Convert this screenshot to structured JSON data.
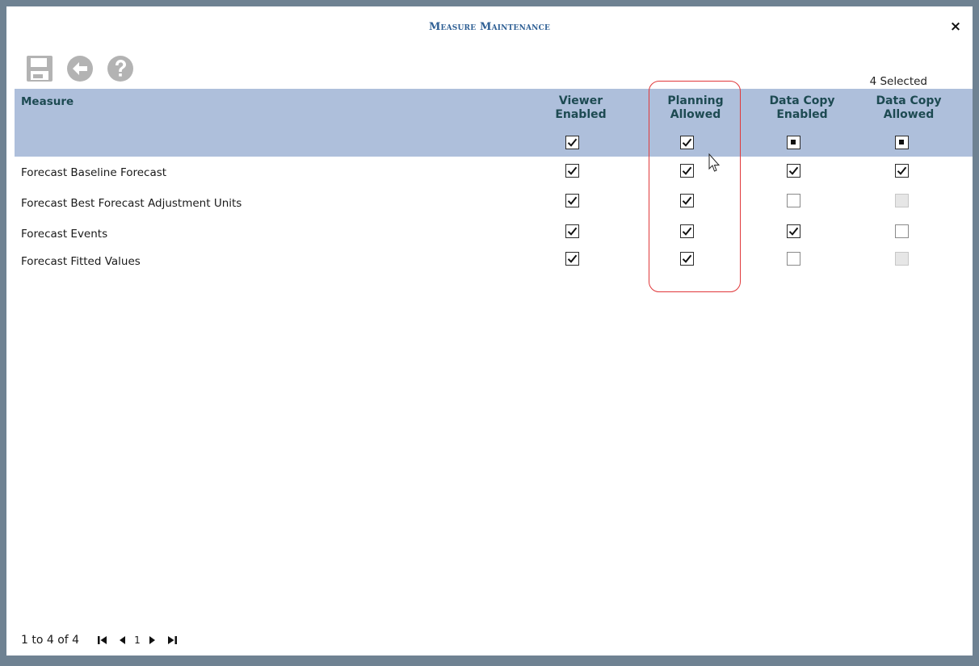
{
  "dialog": {
    "title": "Measure Maintenance",
    "close_label": "×"
  },
  "toolbar": {
    "save_icon": "save-icon",
    "back_icon": "back-arrow-icon",
    "help_icon": "help-icon",
    "selected_text": "4 Selected"
  },
  "table": {
    "header_measure": "Measure",
    "columns": [
      {
        "label": "Viewer\nEnabled",
        "header_state": "checked"
      },
      {
        "label": "Planning\nAllowed",
        "header_state": "checked"
      },
      {
        "label": "Data Copy\nEnabled",
        "header_state": "indeterminate"
      },
      {
        "label": "Data Copy\nAllowed",
        "header_state": "indeterminate"
      }
    ],
    "rows": [
      {
        "measure": "Forecast Baseline Forecast",
        "states": [
          "checked",
          "checked",
          "checked",
          "checked"
        ]
      },
      {
        "measure": "Forecast Best Forecast Adjustment Units",
        "states": [
          "checked",
          "checked",
          "unchecked",
          "disabled"
        ]
      },
      {
        "measure": "Forecast Events",
        "states": [
          "checked",
          "checked",
          "checked",
          "unchecked"
        ]
      },
      {
        "measure": "Forecast Fitted Values",
        "states": [
          "checked",
          "checked",
          "unchecked",
          "disabled"
        ]
      }
    ]
  },
  "pager": {
    "range_text": "1 to 4 of 4",
    "current_page": "1"
  },
  "colors": {
    "header_bg": "#aebfdb",
    "title_color": "#2e5f94",
    "highlight": "#e0383a",
    "frame": "#6f8292"
  }
}
